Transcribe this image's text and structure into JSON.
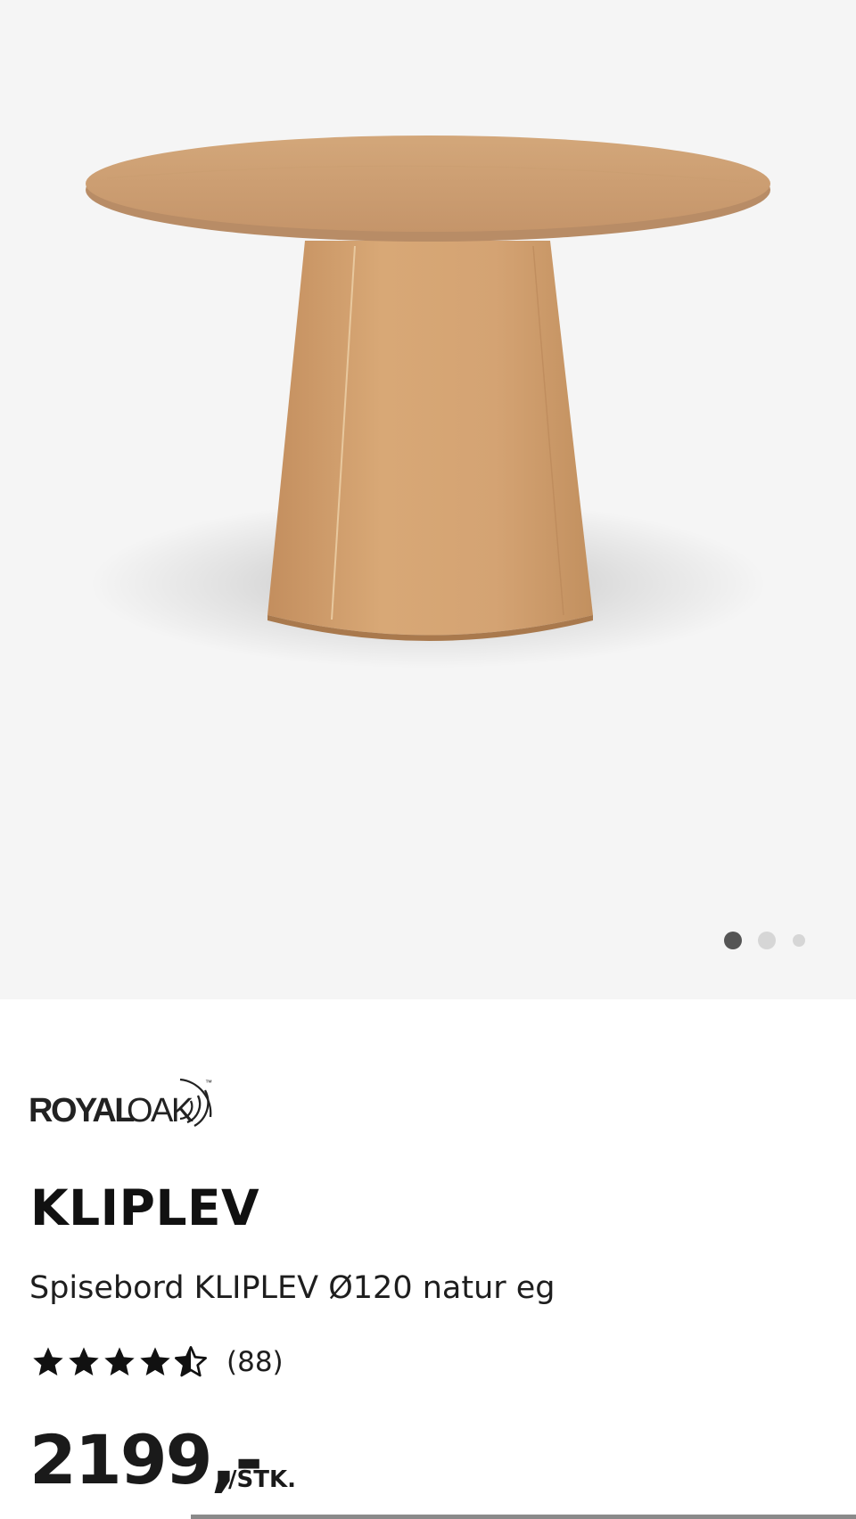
{
  "gallery": {
    "image_alt": "Spisebord KLIPLEV Ø120 natur eg",
    "dots": [
      {
        "active": true
      },
      {
        "active": false
      },
      {
        "active": false
      }
    ]
  },
  "brand": {
    "logo_text_bold": "ROYAL",
    "logo_text_light": "OAK",
    "logo_mark": "™"
  },
  "product": {
    "name": "KLIPLEV",
    "description": "Spisebord KLIPLEV Ø120 natur eg",
    "rating": {
      "stars": 4.5,
      "max": 5,
      "count_label": "(88)"
    },
    "price": "2199,-",
    "unit": "/STK."
  },
  "colors": {
    "gallery_bg": "#f5f5f5",
    "active_dot": "#555555",
    "inactive_dot": "#d6d6d6",
    "text": "#1a1a1a"
  }
}
